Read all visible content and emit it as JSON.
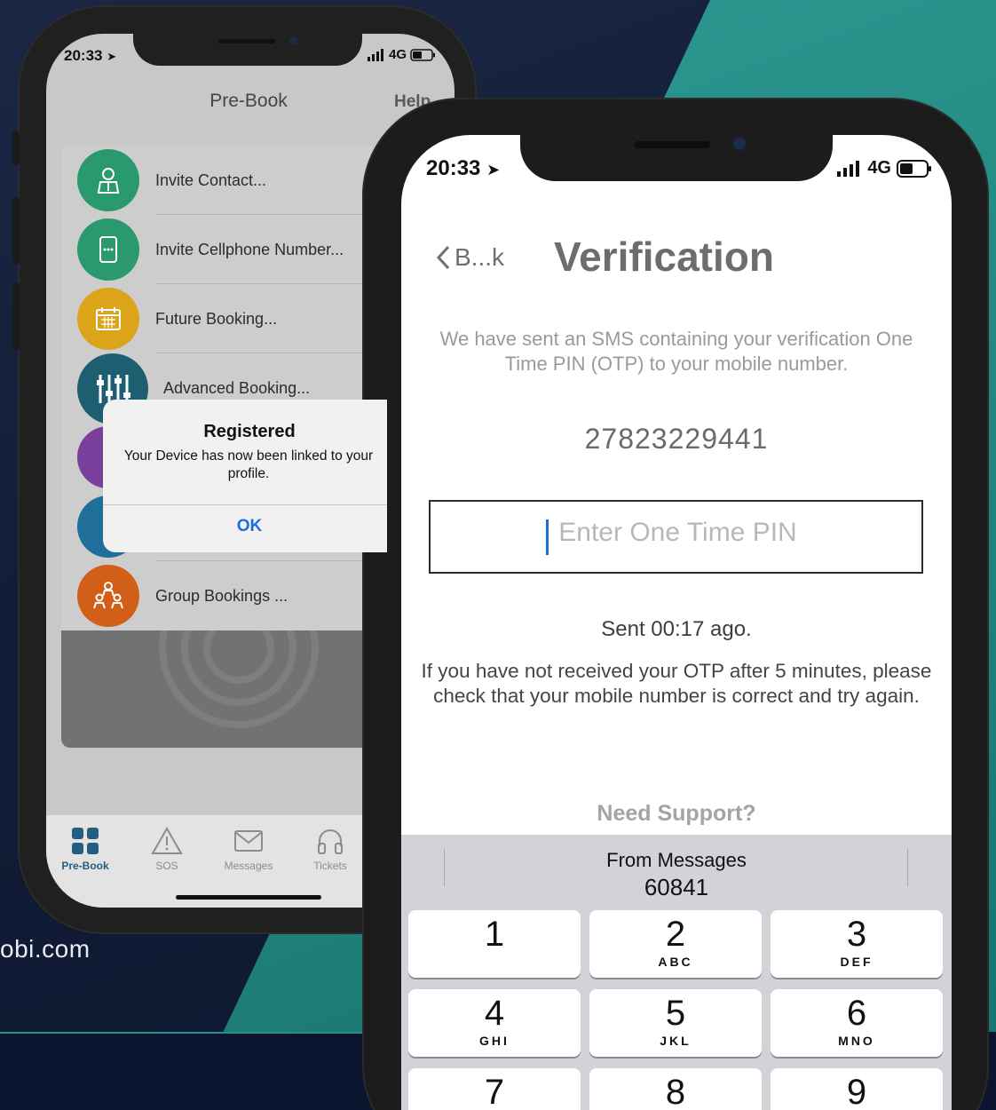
{
  "background": {
    "domain_text": "obi.com",
    "colors": {
      "navy": "#121c36",
      "teal": "#1f8a83"
    }
  },
  "back_phone": {
    "status": {
      "time": "20:33",
      "network": "4G"
    },
    "header": {
      "title": "Pre-Book",
      "right_action": "Help"
    },
    "menu": [
      {
        "label": "Invite Contact...",
        "icon": "contact-person-icon",
        "color": "#2a9a6e"
      },
      {
        "label": "Invite Cellphone Number...",
        "icon": "cellphone-icon",
        "color": "#2a9a6e"
      },
      {
        "label": "Future Booking...",
        "icon": "calendar-icon",
        "color": "#dca41a"
      },
      {
        "label": "Advanced Booking...",
        "icon": "sliders-icon",
        "color": "#1d5f70"
      },
      {
        "label": "",
        "icon": "list-icon",
        "color": "#7a3f9a"
      },
      {
        "label": "",
        "icon": "contact-card-icon",
        "color": "#1f6f9a"
      },
      {
        "label": "Group Bookings ...",
        "icon": "group-icon",
        "color": "#d25f18"
      }
    ],
    "alert": {
      "title": "Registered",
      "message": "Your Device has now been linked to your profile.",
      "ok": "OK"
    },
    "tabs": [
      {
        "label": "Pre-Book",
        "icon": "grid-icon",
        "active": true
      },
      {
        "label": "SOS",
        "icon": "warning-icon",
        "active": false
      },
      {
        "label": "Messages",
        "icon": "envelope-icon",
        "active": false
      },
      {
        "label": "Tickets",
        "icon": "headphones-icon",
        "active": false
      }
    ]
  },
  "front_phone": {
    "status": {
      "time": "20:33",
      "network": "4G"
    },
    "nav": {
      "back_label": "B...k",
      "title": "Verification"
    },
    "sms_message": "We have sent an SMS containing your verification One Time PIN (OTP) to your mobile number.",
    "phone_number": "27823229441",
    "otp_input": {
      "value": "",
      "placeholder": "Enter One Time PIN"
    },
    "sent_text": "Sent 00:17 ago.",
    "help_text": "If you have not received your OTP after 5 minutes, please check that your mobile number is correct and try again.",
    "support_link": "Need Support?",
    "keyboard": {
      "suggestion_source": "From Messages",
      "suggestion_code": "60841",
      "keys": [
        {
          "num": "1",
          "letters": ""
        },
        {
          "num": "2",
          "letters": "ABC"
        },
        {
          "num": "3",
          "letters": "DEF"
        },
        {
          "num": "4",
          "letters": "GHI"
        },
        {
          "num": "5",
          "letters": "JKL"
        },
        {
          "num": "6",
          "letters": "MNO"
        },
        {
          "num": "7",
          "letters": ""
        },
        {
          "num": "8",
          "letters": ""
        },
        {
          "num": "9",
          "letters": ""
        }
      ]
    }
  }
}
